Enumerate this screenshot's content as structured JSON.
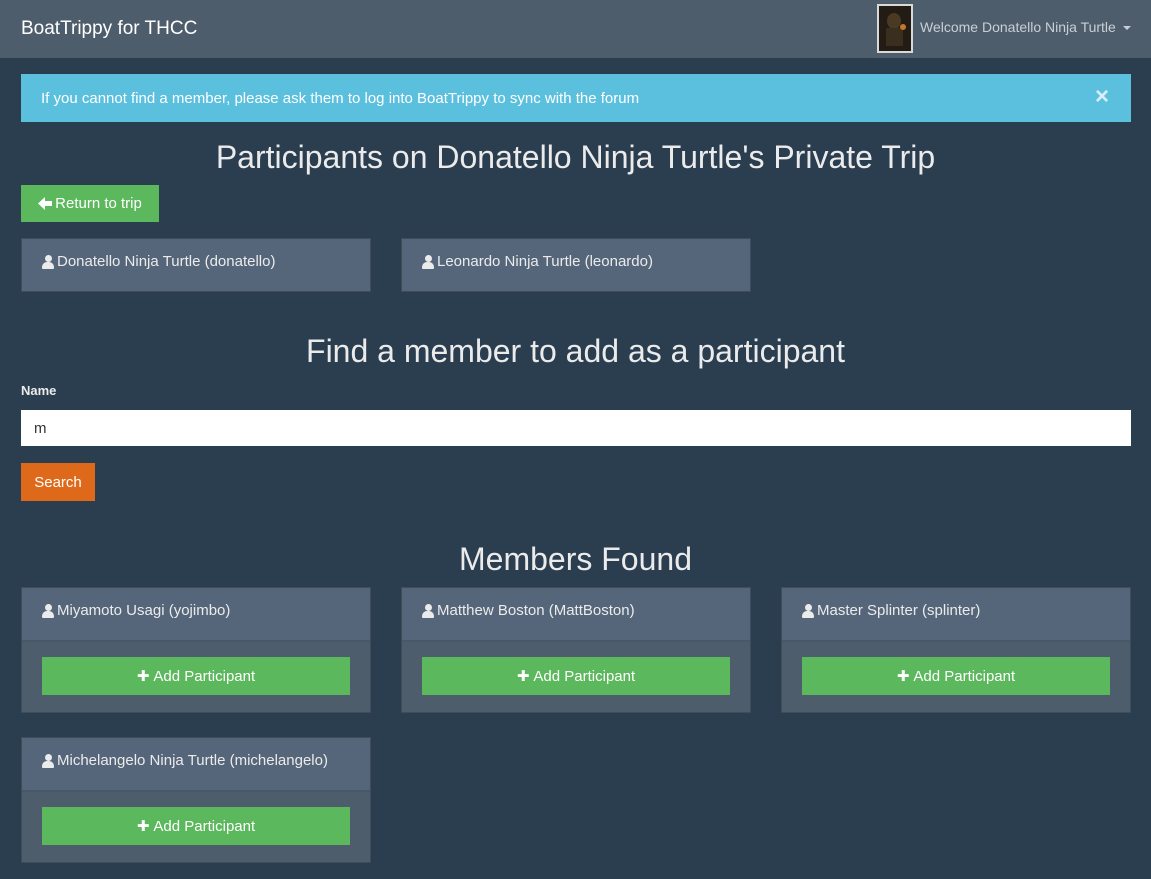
{
  "navbar": {
    "brand": "BoatTrippy for THCC",
    "welcome": "Welcome Donatello Ninja Turtle"
  },
  "alert": {
    "text": "If you cannot find a member, please ask them to log into BoatTrippy to sync with the forum",
    "close": "×"
  },
  "page": {
    "title": "Participants on Donatello Ninja Turtle's Private Trip",
    "return_label": "Return to trip"
  },
  "participants": [
    {
      "name": "Donatello Ninja Turtle (donatello)"
    },
    {
      "name": "Leonardo Ninja Turtle (leonardo)"
    }
  ],
  "search": {
    "heading": "Find a member to add as a participant",
    "label": "Name",
    "value": "m",
    "button": "Search"
  },
  "results": {
    "heading": "Members Found",
    "add_label": "Add Participant",
    "members": [
      {
        "name": "Miyamoto Usagi (yojimbo)"
      },
      {
        "name": "Matthew Boston (MattBoston)"
      },
      {
        "name": "Master Splinter (splinter)"
      },
      {
        "name": "Michelangelo Ninja Turtle (michelangelo)"
      }
    ]
  },
  "colors": {
    "background": "#2b3e50",
    "navbar": "#4e5d6c",
    "alert": "#5bc0de",
    "success": "#5cb85c",
    "warning": "#df691a"
  }
}
